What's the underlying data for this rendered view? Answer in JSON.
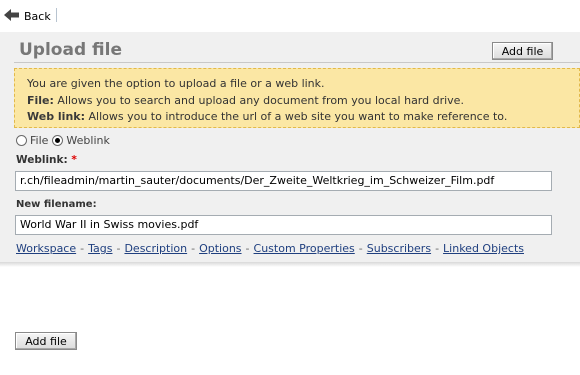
{
  "toolbar": {
    "back_label": "Back"
  },
  "page": {
    "title": "Upload file",
    "add_file_label": "Add file"
  },
  "info": {
    "intro": "You are given the option to upload a file or a web link.",
    "file_term": "File:",
    "file_desc": "Allows you to search and upload any document from you local hard drive.",
    "weblink_term": "Web link:",
    "weblink_desc": "Allows you to introduce the url of a web site you want to make reference to."
  },
  "source": {
    "options": [
      {
        "label": "File",
        "checked": false
      },
      {
        "label": "Weblink",
        "checked": true
      }
    ]
  },
  "form": {
    "weblink_label": "Weblink:",
    "required_mark": "*",
    "weblink_value": "r.ch/fileadmin/martin_sauter/documents/Der_Zweite_Weltkrieg_im_Schweizer_Film.pdf",
    "filename_label": "New filename:",
    "filename_value": "World War II in Swiss movies.pdf"
  },
  "tabs": [
    "Workspace",
    "Tags",
    "Description",
    "Options",
    "Custom Properties",
    "Subscribers",
    "Linked Objects"
  ],
  "footer": {
    "add_file_label": "Add file"
  },
  "colors": {
    "info_bg": "#fbe7a4",
    "info_border": "#e2b94a",
    "link": "#1f3f7f",
    "required": "#dd0000"
  }
}
